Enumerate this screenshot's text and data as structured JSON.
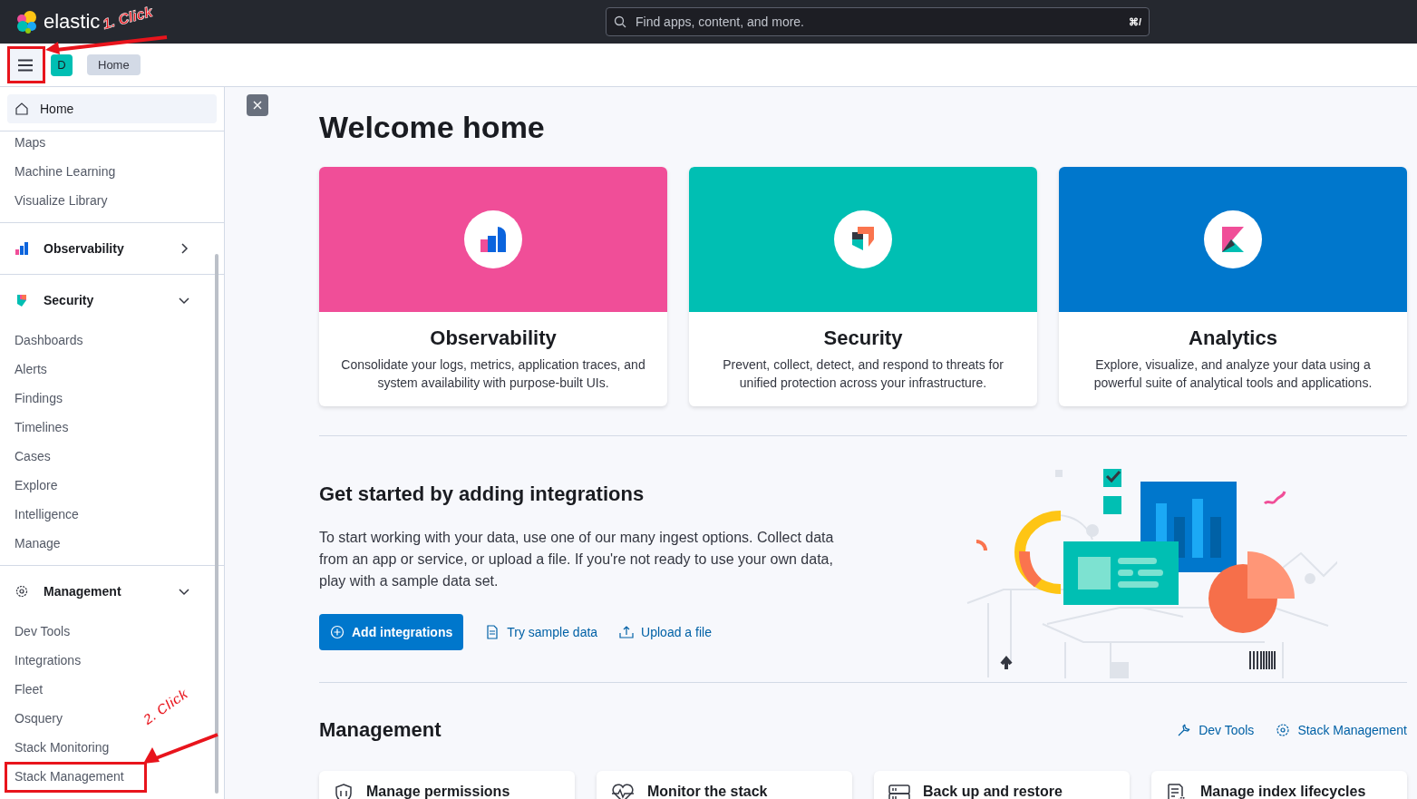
{
  "header": {
    "logo": "elastic",
    "search": {
      "placeholder": "Find apps, content, and more.",
      "shortcut": "⌘/"
    }
  },
  "subheader": {
    "space_avatar": "D",
    "breadcrumbs": [
      {
        "label": "Home"
      }
    ]
  },
  "sidebar": {
    "home": {
      "label": "Home",
      "selected": true
    },
    "items": [
      {
        "label": "Maps"
      },
      {
        "label": "Machine Learning"
      },
      {
        "label": "Visualize Library"
      }
    ],
    "groups": [
      {
        "kind": "observability",
        "title": "Observability",
        "expanded": false
      },
      {
        "kind": "security",
        "title": "Security",
        "expanded": true,
        "items": [
          {
            "label": "Dashboards"
          },
          {
            "label": "Alerts"
          },
          {
            "label": "Findings"
          },
          {
            "label": "Timelines"
          },
          {
            "label": "Cases"
          },
          {
            "label": "Explore"
          },
          {
            "label": "Intelligence"
          },
          {
            "label": "Manage"
          }
        ]
      },
      {
        "kind": "management",
        "title": "Management",
        "expanded": true,
        "items": [
          {
            "label": "Dev Tools"
          },
          {
            "label": "Integrations"
          },
          {
            "label": "Fleet"
          },
          {
            "label": "Osquery"
          },
          {
            "label": "Stack Monitoring"
          },
          {
            "label": "Stack Management"
          }
        ]
      }
    ]
  },
  "main": {
    "title": "Welcome home",
    "solutions": [
      {
        "kind": "observability",
        "title": "Observability",
        "description": "Consolidate your logs, metrics, application traces, and system availability with purpose-built UIs.",
        "color": "#f04e98"
      },
      {
        "kind": "security",
        "title": "Security",
        "description": "Prevent, collect, detect, and respond to threats for unified protection across your infrastructure.",
        "color": "#00bfb3"
      },
      {
        "kind": "analytics",
        "title": "Analytics",
        "description": "Explore, visualize, and analyze your data using a powerful suite of analytical tools and applications.",
        "color": "#0077cc"
      }
    ],
    "integrations": {
      "title": "Get started by adding integrations",
      "body": "To start working with your data, use one of our many ingest options. Collect data from an app or service, or upload a file. If you're not ready to use your own data, play with a sample data set.",
      "actions": [
        {
          "kind": "primary",
          "label": "Add integrations"
        },
        {
          "kind": "sample",
          "label": "Try sample data"
        },
        {
          "kind": "upload",
          "label": "Upload a file"
        }
      ]
    },
    "management": {
      "title": "Management",
      "links": [
        {
          "kind": "devtools",
          "label": "Dev Tools"
        },
        {
          "kind": "settings",
          "label": "Stack Management"
        }
      ],
      "cards": [
        {
          "kind": "permissions",
          "title": "Manage permissions"
        },
        {
          "kind": "monitor",
          "title": "Monitor the stack"
        },
        {
          "kind": "backup",
          "title": "Back up and restore"
        },
        {
          "kind": "lifecycle",
          "title": "Manage index lifecycles"
        }
      ]
    }
  },
  "annotations": [
    {
      "text": "1. Click"
    },
    {
      "text": "2. Click"
    }
  ]
}
